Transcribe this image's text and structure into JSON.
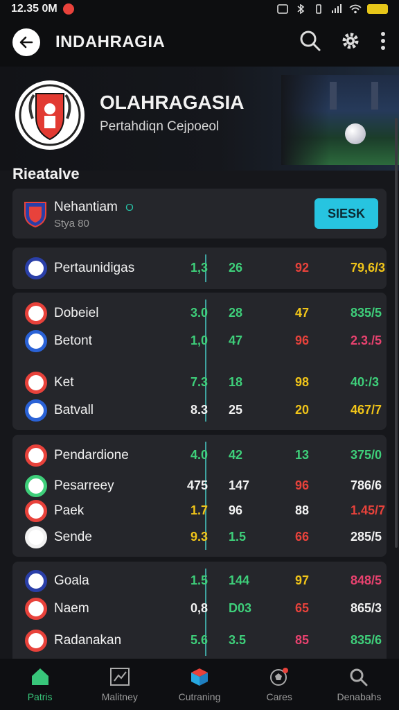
{
  "status_bar": {
    "time": "12.35 0M"
  },
  "app_bar": {
    "title": "INDAHRAGIA"
  },
  "header": {
    "club_name": "OLAHRAGASIA",
    "club_subtitle": "Pertahdiqn Cejpoeol"
  },
  "section": {
    "title": "Rieatalve"
  },
  "featured": {
    "name": "Nehantiam",
    "indicator": "O",
    "sub": "Stya 80",
    "button_label": "SIESK"
  },
  "groups": [
    {
      "rows": [
        {
          "name": "Pertaunidigas",
          "c1": "1,3",
          "c2": "26",
          "c3": "92",
          "c4": "79,6/3",
          "color1": "#3ecf7a",
          "color2": "#3ecf7a",
          "color3": "#e8423b",
          "color4": "#f0c419",
          "icon_color": "#2a3fa8"
        }
      ]
    },
    {
      "rows": [
        {
          "name": "Dobeiel",
          "c1": "3.0",
          "c2": "28",
          "c3": "47",
          "c4": "835/5",
          "color1": "#3ecf7a",
          "color2": "#3ecf7a",
          "color3": "#f0c419",
          "color4": "#3ecf7a",
          "icon_color": "#e8423b"
        },
        {
          "name": "Betont",
          "c1": "1,0",
          "c2": "47",
          "c3": "96",
          "c4": "2.3./5",
          "color1": "#3ecf7a",
          "color2": "#3ecf7a",
          "color3": "#e8423b",
          "color4": "#e8426f",
          "icon_color": "#2a62d6"
        },
        {
          "name": "Ket",
          "c1": "7.3",
          "c2": "18",
          "c3": "98",
          "c4": "40:/3",
          "color1": "#3ecf7a",
          "color2": "#3ecf7a",
          "color3": "#f0c419",
          "color4": "#3ecf7a",
          "icon_color": "#e8423b"
        },
        {
          "name": "Batvall",
          "c1": "8.3",
          "c2": "25",
          "c3": "20",
          "c4": "467/7",
          "color1": "#f2f2f2",
          "color2": "#f2f2f2",
          "color3": "#f0c419",
          "color4": "#f0c419",
          "icon_color": "#2a62d6"
        }
      ]
    },
    {
      "rows": [
        {
          "name": "Pendardione",
          "c1": "4.0",
          "c2": "42",
          "c3": "13",
          "c4": "375/0",
          "color1": "#3ecf7a",
          "color2": "#3ecf7a",
          "color3": "#3ecf7a",
          "color4": "#3ecf7a",
          "icon_color": "#e8423b"
        },
        {
          "name": "Pesarreey",
          "c1": "475",
          "c2": "147",
          "c3": "96",
          "c4": "786/6",
          "color1": "#f2f2f2",
          "color2": "#f2f2f2",
          "color3": "#e8423b",
          "color4": "#f2f2f2",
          "icon_color": "#3ecf7a"
        },
        {
          "name": "Paek",
          "c1": "1.7",
          "c2": "96",
          "c3": "88",
          "c4": "1.45/7",
          "color1": "#f0c419",
          "color2": "#f2f2f2",
          "color3": "#f2f2f2",
          "color4": "#e8423b",
          "icon_color": "#e8423b"
        },
        {
          "name": "Sende",
          "c1": "9.3",
          "c2": "1.5",
          "c3": "66",
          "c4": "285/5",
          "color1": "#f0c419",
          "color2": "#3ecf7a",
          "color3": "#e8423b",
          "color4": "#f2f2f2",
          "icon_color": "#f2f2f2"
        }
      ]
    },
    {
      "rows": [
        {
          "name": "Goala",
          "c1": "1.5",
          "c2": "144",
          "c3": "97",
          "c4": "848/5",
          "color1": "#3ecf7a",
          "color2": "#3ecf7a",
          "color3": "#f0c419",
          "color4": "#e8426f",
          "icon_color": "#2a3fa8"
        },
        {
          "name": "Naem",
          "c1": "0,8",
          "c2": "D03",
          "c3": "65",
          "c4": "865/3",
          "color1": "#f2f2f2",
          "color2": "#3ecf7a",
          "color3": "#e8423b",
          "color4": "#f2f2f2",
          "icon_color": "#e8423b"
        },
        {
          "name": "Radanakan",
          "c1": "5.6",
          "c2": "3.5",
          "c3": "85",
          "c4": "835/6",
          "color1": "#3ecf7a",
          "color2": "#3ecf7a",
          "color3": "#e8426f",
          "color4": "#3ecf7a",
          "icon_color": "#e8423b"
        }
      ]
    }
  ],
  "nav": [
    {
      "label": "Patris",
      "icon": "home-icon"
    },
    {
      "label": "Malitney",
      "icon": "chart-icon"
    },
    {
      "label": "Cutraning",
      "icon": "box-icon"
    },
    {
      "label": "Cares",
      "icon": "ball-icon"
    },
    {
      "label": "Denabahs",
      "icon": "search-icon"
    }
  ],
  "colors": {
    "accent": "#38c67a",
    "button": "#27c4e0",
    "background": "#16171b",
    "card": "#25262b"
  }
}
